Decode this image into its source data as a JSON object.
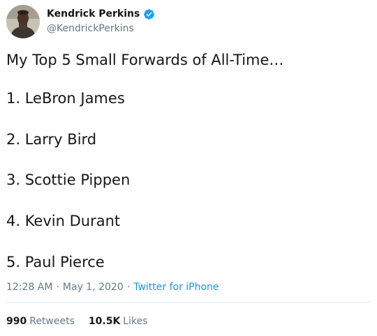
{
  "author": {
    "display_name": "Kendrick Perkins",
    "handle": "@KendrickPerkins",
    "verified": true
  },
  "tweet": {
    "intro": "My Top 5 Small Forwards of All-Time…",
    "list": [
      "1. LeBron James",
      "2. Larry Bird",
      "3. Scottie Pippen",
      "4. Kevin Durant",
      "5. Paul Pierce"
    ]
  },
  "meta": {
    "time": "12:28 AM",
    "separator": "·",
    "date": "May 1, 2020",
    "source": "Twitter for iPhone"
  },
  "stats": {
    "retweets_count": "990",
    "retweets_label": "Retweets",
    "likes_count": "10.5K",
    "likes_label": "Likes"
  },
  "colors": {
    "verified_badge": "#1da1f2",
    "link": "#1b95e0",
    "secondary_text": "#657786"
  },
  "icons": {
    "verified": "verified-badge-icon"
  }
}
